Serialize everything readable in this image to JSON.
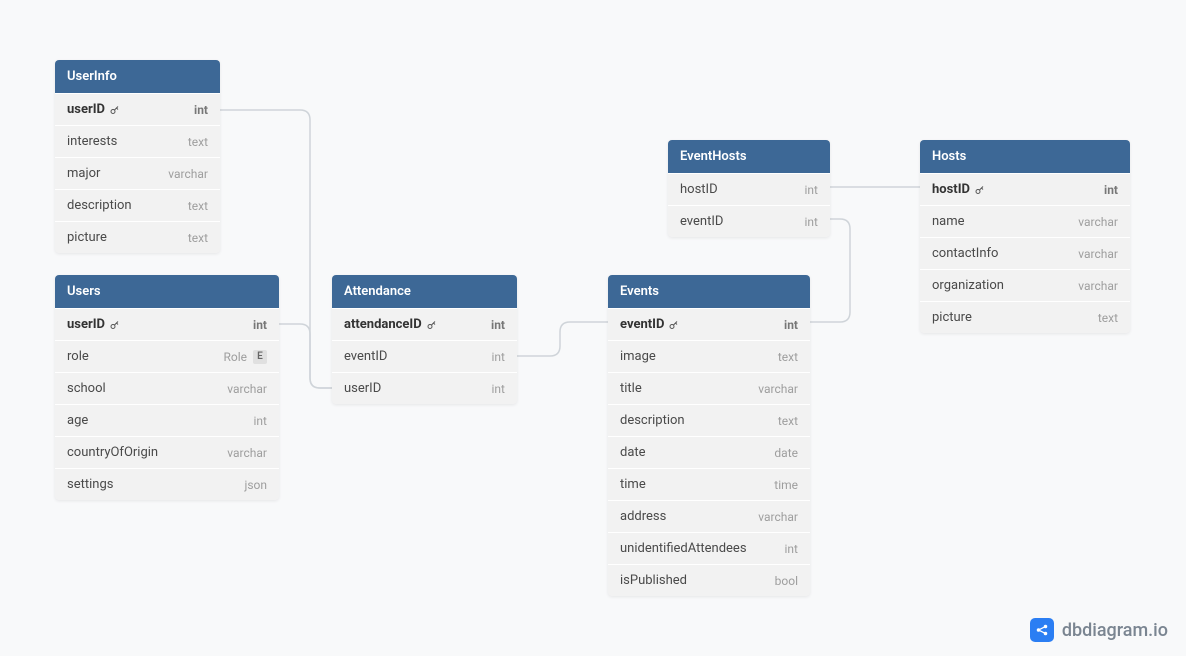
{
  "watermark": "dbdiagram.io",
  "tables": {
    "userInfo": {
      "name": "UserInfo",
      "columns": [
        {
          "name": "userID",
          "type": "int",
          "pk": true
        },
        {
          "name": "interests",
          "type": "text"
        },
        {
          "name": "major",
          "type": "varchar"
        },
        {
          "name": "description",
          "type": "text"
        },
        {
          "name": "picture",
          "type": "text"
        }
      ]
    },
    "users": {
      "name": "Users",
      "columns": [
        {
          "name": "userID",
          "type": "int",
          "pk": true
        },
        {
          "name": "role",
          "type": "Role",
          "enum": "E"
        },
        {
          "name": "school",
          "type": "varchar"
        },
        {
          "name": "age",
          "type": "int"
        },
        {
          "name": "countryOfOrigin",
          "type": "varchar"
        },
        {
          "name": "settings",
          "type": "json"
        }
      ]
    },
    "attendance": {
      "name": "Attendance",
      "columns": [
        {
          "name": "attendanceID",
          "type": "int",
          "pk": true
        },
        {
          "name": "eventID",
          "type": "int"
        },
        {
          "name": "userID",
          "type": "int"
        }
      ]
    },
    "events": {
      "name": "Events",
      "columns": [
        {
          "name": "eventID",
          "type": "int",
          "pk": true
        },
        {
          "name": "image",
          "type": "text"
        },
        {
          "name": "title",
          "type": "varchar"
        },
        {
          "name": "description",
          "type": "text"
        },
        {
          "name": "date",
          "type": "date"
        },
        {
          "name": "time",
          "type": "time"
        },
        {
          "name": "address",
          "type": "varchar"
        },
        {
          "name": "unidentifiedAttendees",
          "type": "int"
        },
        {
          "name": "isPublished",
          "type": "bool"
        }
      ]
    },
    "eventHosts": {
      "name": "EventHosts",
      "columns": [
        {
          "name": "hostID",
          "type": "int"
        },
        {
          "name": "eventID",
          "type": "int"
        }
      ]
    },
    "hosts": {
      "name": "Hosts",
      "columns": [
        {
          "name": "hostID",
          "type": "int",
          "pk": true
        },
        {
          "name": "name",
          "type": "varchar"
        },
        {
          "name": "contactInfo",
          "type": "varchar"
        },
        {
          "name": "organization",
          "type": "varchar"
        },
        {
          "name": "picture",
          "type": "text"
        }
      ]
    }
  },
  "relationships": [
    {
      "from": "UserInfo.userID",
      "to": "Attendance.userID"
    },
    {
      "from": "Users.userID",
      "to": "Attendance.userID"
    },
    {
      "from": "Attendance.eventID",
      "to": "Events.eventID"
    },
    {
      "from": "EventHosts.eventID",
      "to": "Events.eventID"
    },
    {
      "from": "EventHosts.hostID",
      "to": "Hosts.hostID"
    }
  ]
}
